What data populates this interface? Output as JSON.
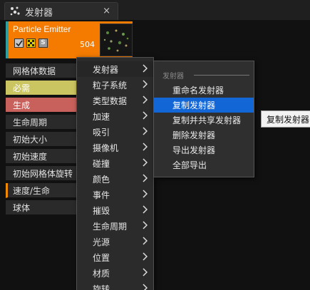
{
  "tab": {
    "title": "发射器",
    "close": "×",
    "icon": "particle-system-icon"
  },
  "emitter": {
    "name": "Particle Emitter",
    "count": "504",
    "solo_label": "S",
    "accent": "#f47a00",
    "stripe": "#2e9ea0"
  },
  "modules": [
    {
      "label": "网格体数据"
    },
    {
      "label": "必需"
    },
    {
      "label": "生成"
    },
    {
      "label": "生命周期"
    },
    {
      "label": "初始大小"
    },
    {
      "label": "初始速度"
    },
    {
      "label": "初始网格体旋转"
    },
    {
      "label": "速度/生命"
    },
    {
      "label": "球体"
    }
  ],
  "menu": {
    "items": [
      {
        "label": "发射器"
      },
      {
        "label": "粒子系统"
      },
      {
        "label": "类型数据"
      },
      {
        "label": "加速"
      },
      {
        "label": "吸引"
      },
      {
        "label": "摄像机"
      },
      {
        "label": "碰撞"
      },
      {
        "label": "颜色"
      },
      {
        "label": "事件"
      },
      {
        "label": "摧毁"
      },
      {
        "label": "生命周期"
      },
      {
        "label": "光源"
      },
      {
        "label": "位置"
      },
      {
        "label": "材质"
      },
      {
        "label": "旋转"
      }
    ]
  },
  "submenu": {
    "header": "发射器",
    "items": [
      {
        "label": "重命名发射器"
      },
      {
        "label": "复制发射器"
      },
      {
        "label": "复制并共享发射器"
      },
      {
        "label": "删除发射器"
      },
      {
        "label": "导出发射器"
      },
      {
        "label": "全部导出"
      }
    ]
  },
  "tooltip": {
    "text": "复制发射器"
  },
  "colors": {
    "selection": "#1366d6",
    "required": "#cbc561",
    "spawn": "#c8605c"
  }
}
